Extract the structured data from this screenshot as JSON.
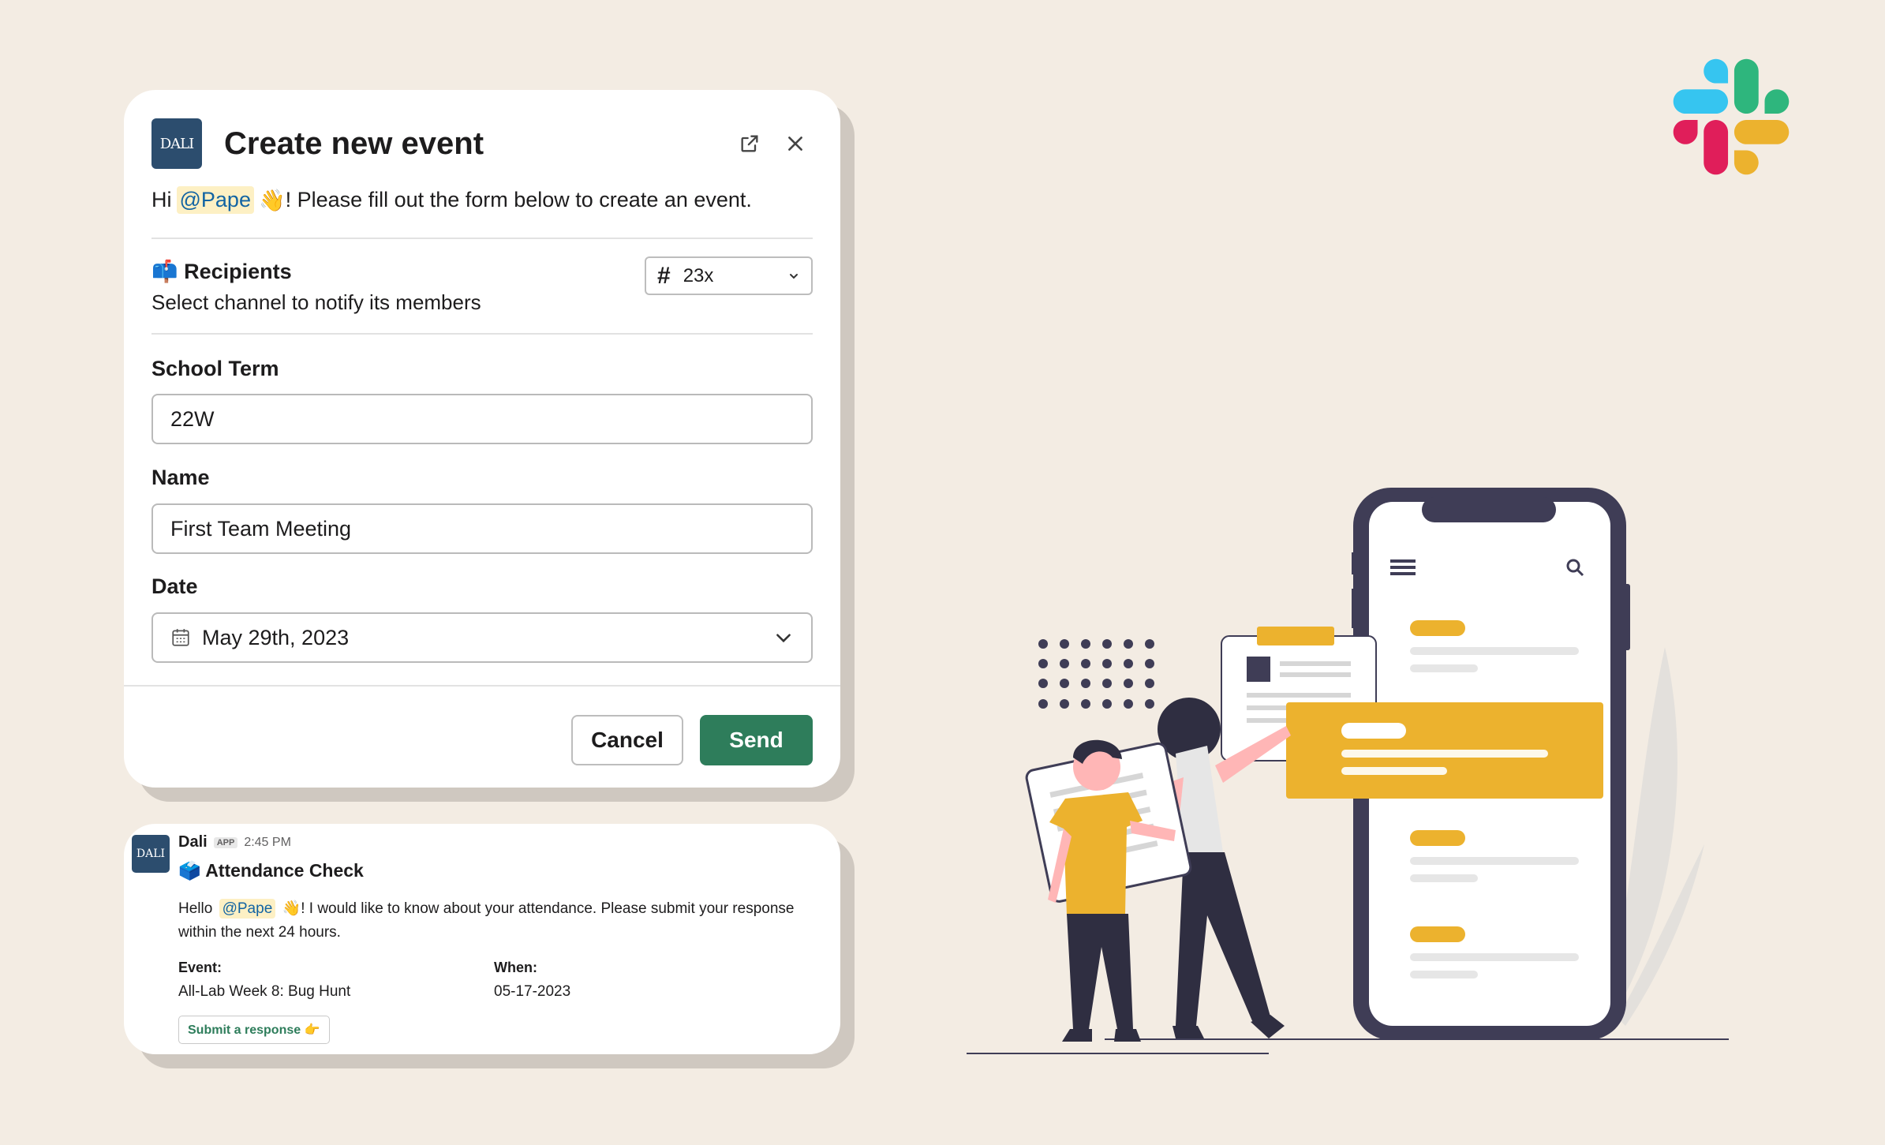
{
  "modal": {
    "logo_text": "DALI",
    "title": "Create new event",
    "greeting_prefix": "Hi",
    "mention": "@Pape",
    "wave_emoji": "👋",
    "greeting_suffix": "! Please fill out the form below to create an event.",
    "recipients": {
      "emoji": "📫",
      "title": "Recipients",
      "subtitle": "Select channel to notify its members",
      "channel_hash": "#",
      "channel_value": "23x"
    },
    "school_term": {
      "label": "School Term",
      "value": "22W"
    },
    "name": {
      "label": "Name",
      "value": "First Team Meeting"
    },
    "date": {
      "label": "Date",
      "value": "May 29th, 2023"
    },
    "cancel_label": "Cancel",
    "send_label": "Send"
  },
  "message": {
    "logo_text": "DALI",
    "sender": "Dali",
    "app_badge": "APP",
    "time": "2:45 PM",
    "title_emoji": "🗳️",
    "title": "Attendance Check",
    "body_prefix": "Hello",
    "mention": "@Pape",
    "wave_emoji": "👋",
    "body_suffix": "! I would like to know about your attendance. Please submit your response within the next 24 hours.",
    "event_label": "Event:",
    "event_value": "All-Lab Week 8: Bug Hunt",
    "when_label": "When:",
    "when_value": "05-17-2023",
    "submit_label": "Submit a response 👉"
  },
  "colors": {
    "background": "#f3ece3",
    "send_button": "#2e7d5b",
    "dali_logo": "#2c4d6e",
    "mention_bg": "#fdf0c4",
    "illustration_accent": "#ecb22e",
    "illustration_dark": "#3f3d56"
  },
  "icons": {
    "popout": "external-link-icon",
    "close": "close-icon",
    "dropdown": "chevron-down-icon",
    "calendar": "calendar-icon",
    "menu": "hamburger-menu-icon",
    "search": "search-icon",
    "brand": "slack-logo"
  }
}
